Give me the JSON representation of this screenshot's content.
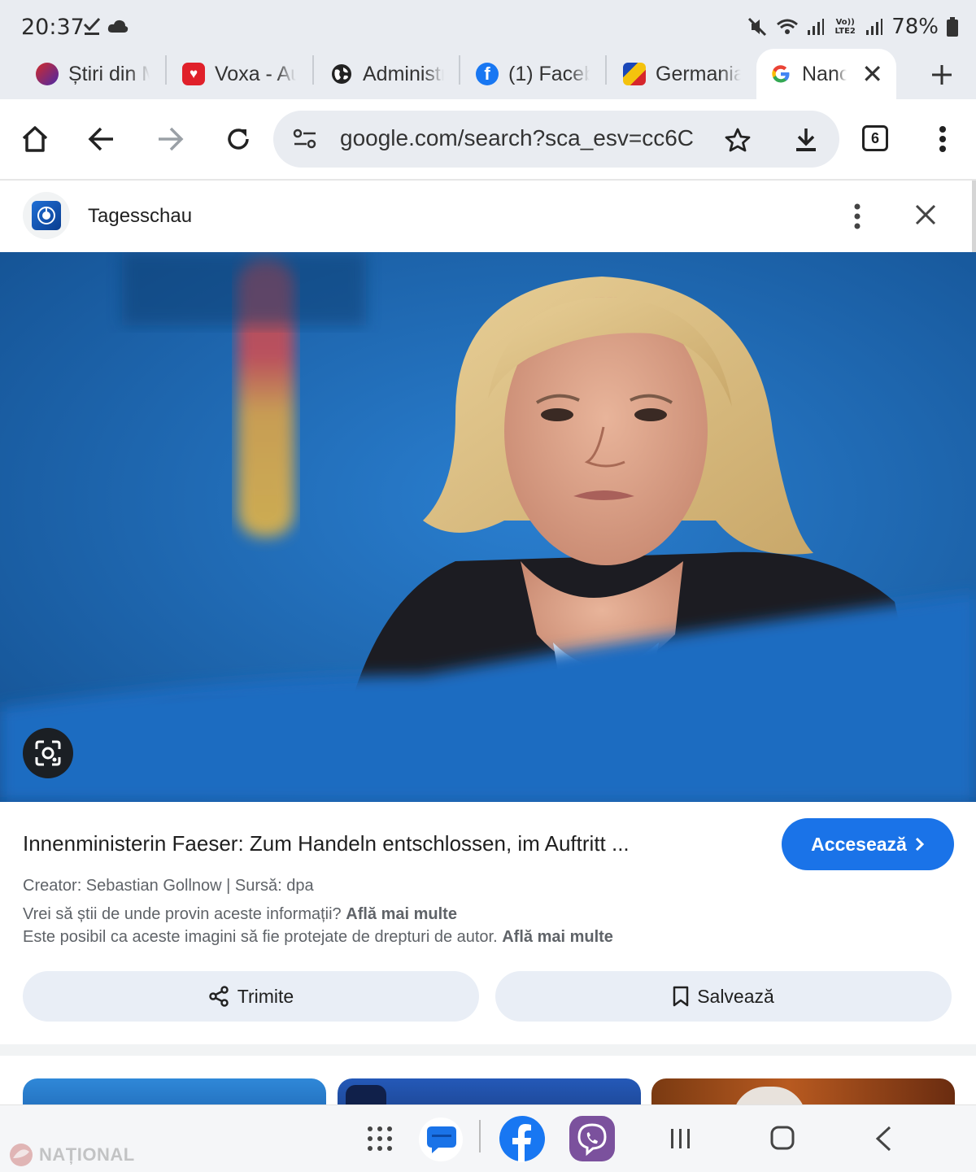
{
  "status_bar": {
    "time": "20:37",
    "battery": "78%",
    "network_label": "Vo)) LTE2"
  },
  "tabs": [
    {
      "label": "Știri din M",
      "favicon": "stiri-favicon"
    },
    {
      "label": "Voxa - Au",
      "favicon": "voxa-favicon"
    },
    {
      "label": "Administr",
      "favicon": "globe-icon"
    },
    {
      "label": "(1) Faceb",
      "favicon": "facebook-favicon"
    },
    {
      "label": "Germania",
      "favicon": "germania-favicon"
    },
    {
      "label": "Nancy",
      "favicon": "google-favicon",
      "active": true
    }
  ],
  "toolbar": {
    "url": "google.com/search?sca_esv=cc6C",
    "tab_count": "6"
  },
  "source": {
    "name": "Tagesschau"
  },
  "result": {
    "headline": "Innenministerin Faeser: Zum Handeln entschlossen, im Auftritt ...",
    "visit_label": "Accesează",
    "creator": "Creator: Sebastian Gollnow | Sursă: dpa",
    "info_q": "Vrei să știi de unde provin aceste informații?",
    "info_q_link": "Află mai multe",
    "copyright": "Este posibil ca aceste imagini să fie protejate de drepturi de autor.",
    "copyright_link": "Află mai multe",
    "share_label": "Trimite",
    "save_label": "Salvează"
  },
  "watermark": {
    "text": "NAȚIONAL"
  },
  "colors": {
    "accent": "#1a73e8",
    "chrome_bg": "#e9ecf1",
    "hero_blue": "#1e6ab8"
  }
}
